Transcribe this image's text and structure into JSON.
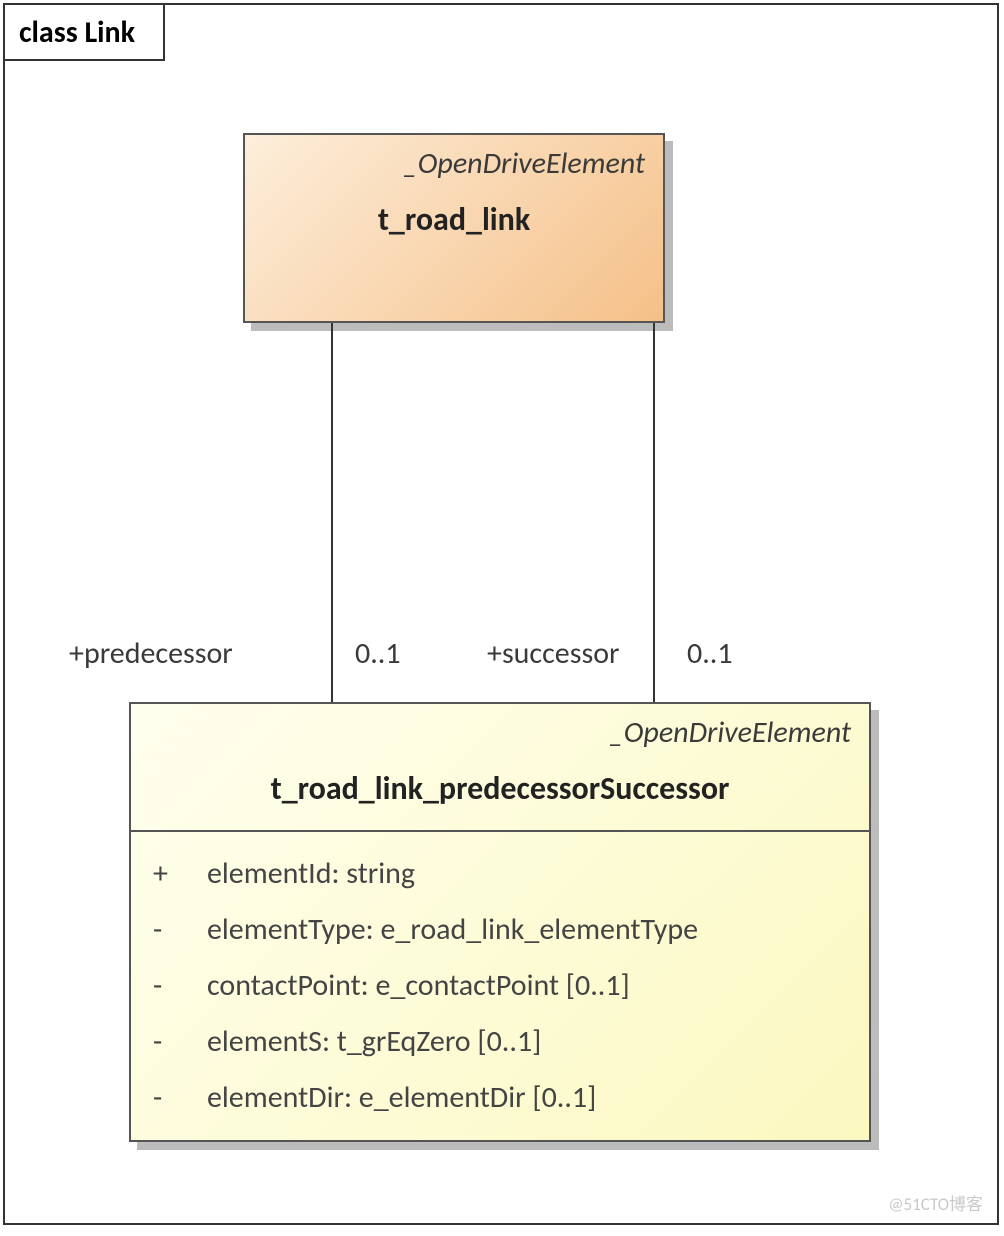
{
  "diagram": {
    "title": "class Link",
    "top_class": {
      "stereotype": "_OpenDriveElement",
      "name": "t_road_link"
    },
    "bottom_class": {
      "stereotype": "_OpenDriveElement",
      "name": "t_road_link_predecessorSuccessor",
      "attributes": [
        {
          "visibility": "+",
          "text": "elementId: string"
        },
        {
          "visibility": "-",
          "text": "elementType: e_road_link_elementType"
        },
        {
          "visibility": "-",
          "text": "contactPoint: e_contactPoint [0..1]"
        },
        {
          "visibility": "-",
          "text": "elementS: t_grEqZero [0..1]"
        },
        {
          "visibility": "-",
          "text": "elementDir: e_elementDir [0..1]"
        }
      ]
    },
    "associations": {
      "predecessor": {
        "label": "+predecessor",
        "multiplicity": "0..1"
      },
      "successor": {
        "label": "+successor",
        "multiplicity": "0..1"
      }
    },
    "watermark": "@51CTO博客"
  }
}
